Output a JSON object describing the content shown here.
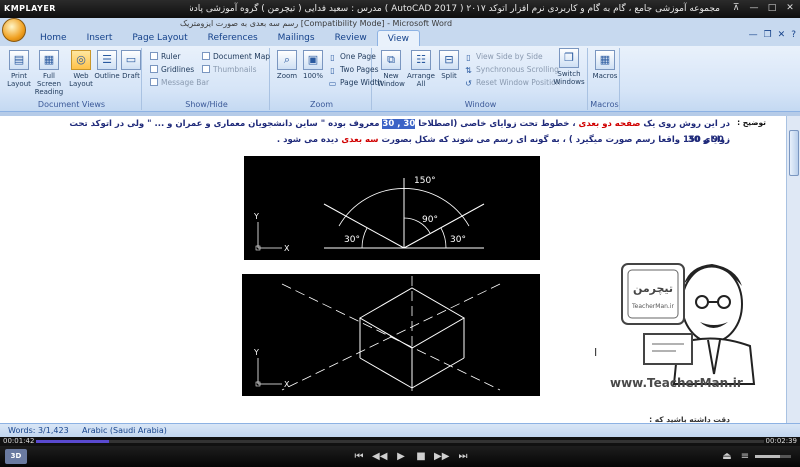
{
  "player": {
    "logo": "KMPLAYER",
    "title": "مجموعه آموزشی جامع ، گام به گام و کاربردی نرم افزار  اتوکد ۲۰۱۷ ( AutoCAD 2017 )   مدرس : سعید فدایی ( تیچرمن ) گروه آموزشی پادشاه گرافیست ها",
    "controls": {
      "pin": "⊼",
      "minimize": "—",
      "maximize": "□",
      "close": "✕"
    },
    "elapsed": "00:01:42",
    "total": "00:02:39",
    "progress": 0.1,
    "volume": 0.7,
    "badge": "3D",
    "buttons": {
      "prev": "⏮",
      "rewind": "◀◀",
      "play": "▶",
      "stop": "■",
      "forward": "▶▶",
      "next": "⏭",
      "eject": "⏏",
      "menu": "≡"
    }
  },
  "word": {
    "title": "رسم سه بعدی به صورت ایزومتریک [Compatibility Mode] - Microsoft Word",
    "tabs": [
      "Home",
      "Insert",
      "Page Layout",
      "References",
      "Mailings",
      "Review",
      "View"
    ],
    "active_tab": "View",
    "window_controls": {
      "minimize": "—",
      "restore": "❐",
      "close": "✕",
      "help": "?"
    },
    "ribbon": {
      "document_views": {
        "label": "Document Views",
        "buttons": [
          {
            "label": "Print Layout",
            "icon": "▤"
          },
          {
            "label": "Full Screen Reading",
            "icon": "▦"
          },
          {
            "label": "Web Layout",
            "icon": "◎"
          },
          {
            "label": "Outline",
            "icon": "☰"
          },
          {
            "label": "Draft",
            "icon": "▭"
          }
        ]
      },
      "show_hide": {
        "label": "Show/Hide",
        "items": [
          {
            "label": "Ruler",
            "enabled": true
          },
          {
            "label": "Gridlines",
            "enabled": true
          },
          {
            "label": "Message Bar",
            "enabled": false
          },
          {
            "label": "Document Map",
            "enabled": true
          },
          {
            "label": "Thumbnails",
            "enabled": false
          }
        ]
      },
      "zoom": {
        "label": "Zoom",
        "zoom_label": "Zoom",
        "percent_label": "100%",
        "one_page": "One Page",
        "two_pages": "Two Pages",
        "page_width": "Page Width"
      },
      "window": {
        "label": "Window",
        "new_window": "New Window",
        "arrange_all": "Arrange All",
        "split": "Split",
        "view_side_by_side": "View Side by Side",
        "synchronous_scrolling": "Synchronous Scrolling",
        "reset_window_position": "Reset Window Position",
        "switch_windows": "Switch Windows"
      },
      "macros": {
        "label": "Macros",
        "button": "Macros"
      }
    },
    "document": {
      "heading": "توضیح :",
      "para_line1_parts": [
        {
          "text": "در  این روش روی یک ",
          "style": "normal"
        },
        {
          "text": "صفحه دو بعدی",
          "style": "red"
        },
        {
          "text": " ، خطوط تحت زوایای خاصی  (اصطلاحا ",
          "style": "normal"
        },
        {
          "text": "30 , 30",
          "style": "hl"
        },
        {
          "text": " معروف بوده \" ساین دانشجویان معماری و عمران و ... \"  ولی در اتوکد تحت زوایای 30",
          "style": "normal"
        }
      ],
      "para_line2_parts": [
        {
          "text": ", 90 و 150 واقعا رسم صورت میگیرد ) ، به گونه ای رسم  می شوند که شکل بصورت ",
          "style": "normal"
        },
        {
          "text": "سه بعدی",
          "style": "red"
        },
        {
          "text": " دیده می شود .",
          "style": "normal"
        }
      ],
      "fig1": {
        "angle_150": "150°",
        "angle_90": "90°",
        "angle_30_left": "30°",
        "angle_30_right": "30°",
        "axis_x": "X",
        "axis_y": "Y"
      },
      "fig2": {
        "axis_x": "X",
        "axis_y": "Y"
      },
      "bottom_partial": "دقت داشته باشید که :",
      "watermark": {
        "logo_text": "تیچرمن",
        "logo_sub": "TeacherMan.ir",
        "url": "www.TeacherMan.ir"
      }
    },
    "status": {
      "words": "Words: 3/1,423",
      "language": "Arabic (Saudi Arabia)"
    }
  }
}
